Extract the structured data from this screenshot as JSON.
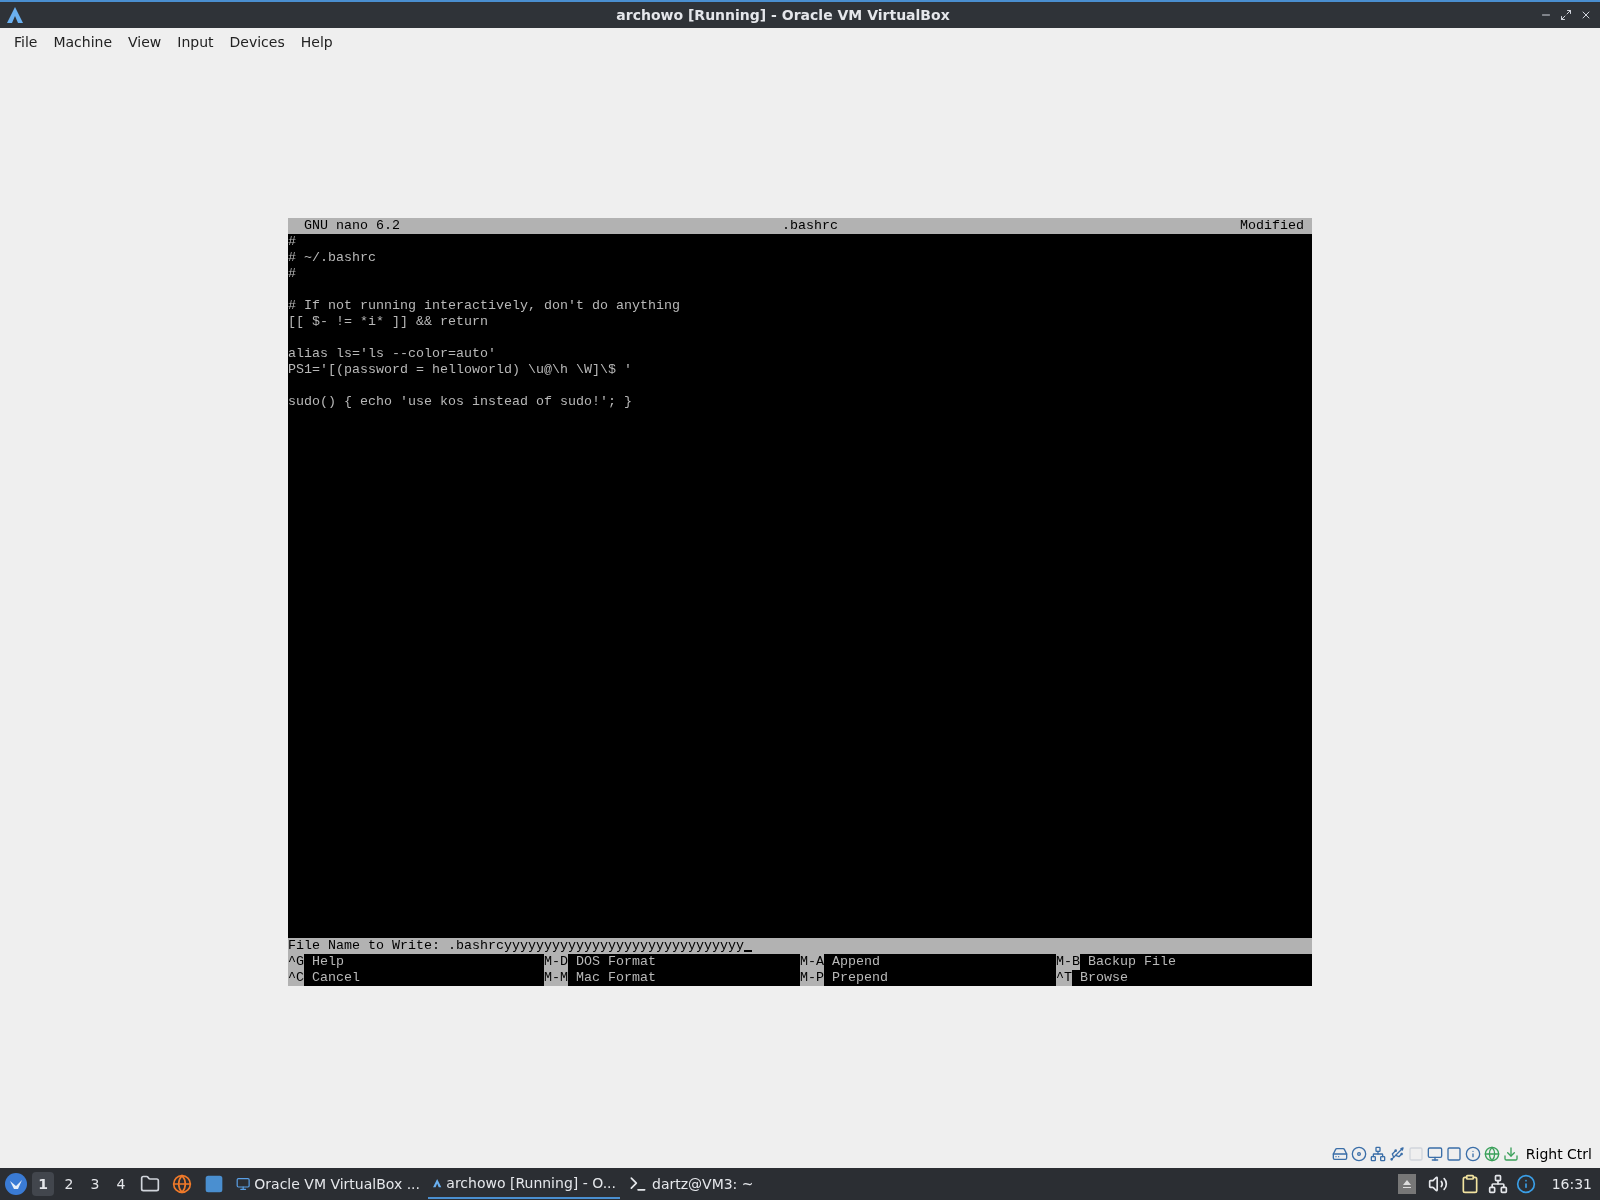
{
  "window": {
    "title": "archowo [Running] - Oracle VM VirtualBox"
  },
  "menu": [
    "File",
    "Machine",
    "View",
    "Input",
    "Devices",
    "Help"
  ],
  "nano": {
    "header": {
      "app": "GNU nano 6.2",
      "file": ".bashrc",
      "status": "Modified"
    },
    "blocks": [
      [
        "#",
        "# ~/.bashrc",
        "#"
      ],
      [
        "# If not running interactively, don't do anything",
        "[[ $- != *i* ]] && return"
      ],
      [
        "alias ls='ls --color=auto'",
        "PS1='[(password = helloworld) \\u@\\h \\W]\\$ '"
      ],
      [
        "sudo() { echo 'use kos instead of sudo!'; }"
      ]
    ],
    "prompt": {
      "label": "File Name to Write:",
      "value": ".bashrcyyyyyyyyyyyyyyyyyyyyyyyyyyyyyy"
    },
    "shortcuts": [
      [
        {
          "key": "^G",
          "label": "Help"
        },
        {
          "key": "^C",
          "label": "Cancel"
        }
      ],
      [
        {
          "key": "M-D",
          "label": "DOS Format"
        },
        {
          "key": "M-M",
          "label": "Mac Format"
        }
      ],
      [
        {
          "key": "M-A",
          "label": "Append"
        },
        {
          "key": "M-P",
          "label": "Prepend"
        }
      ],
      [
        {
          "key": "M-B",
          "label": "Backup File"
        },
        {
          "key": "^T",
          "label": "Browse"
        }
      ]
    ]
  },
  "vm_status": {
    "host_key": "Right Ctrl"
  },
  "taskbar": {
    "workspaces": [
      {
        "label": "1",
        "selected": true
      },
      {
        "label": "2",
        "selected": false
      },
      {
        "label": "3",
        "selected": false
      },
      {
        "label": "4",
        "selected": false
      }
    ],
    "tasks": [
      {
        "kind": "monitor",
        "label": "Oracle VM VirtualBox ...",
        "selected": false
      },
      {
        "kind": "vbox",
        "label": "archowo [Running] - O...",
        "selected": true
      },
      {
        "kind": "terminal",
        "label": "dartz@VM3: ~",
        "selected": false
      }
    ],
    "clock": "16:31"
  }
}
